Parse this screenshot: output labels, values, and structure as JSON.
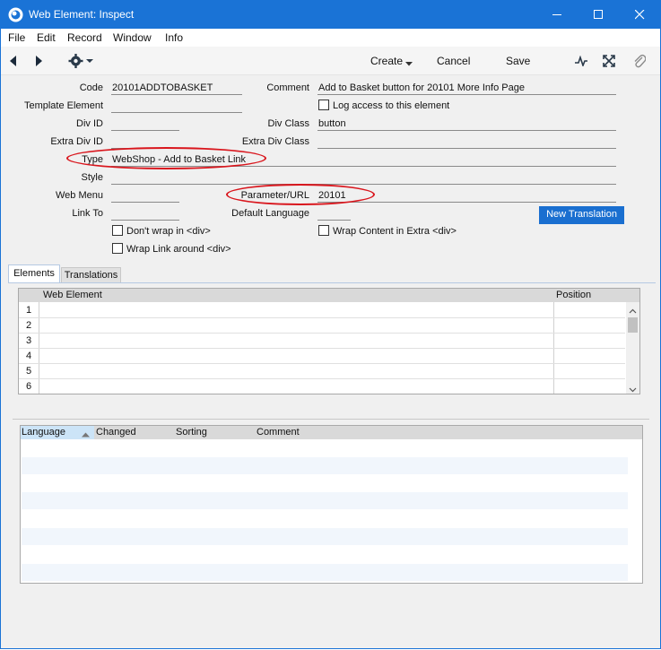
{
  "window": {
    "title": "Web Element: Inspect",
    "accent": "#1a73d6"
  },
  "menu": {
    "items": [
      "File",
      "Edit",
      "Record",
      "Window",
      "Info"
    ]
  },
  "toolbar": {
    "create_label": "Create",
    "cancel_label": "Cancel",
    "save_label": "Save"
  },
  "form": {
    "code_label": "Code",
    "code_value": "20101ADDTOBASKET",
    "comment_label": "Comment",
    "comment_value": "Add to Basket button for 20101 More Info Page",
    "template_element_label": "Template Element",
    "template_element_value": "",
    "log_access_label": "Log access to this element",
    "log_access_checked": false,
    "div_id_label": "Div ID",
    "div_id_value": "",
    "div_class_label": "Div Class",
    "div_class_value": "button",
    "extra_div_id_label": "Extra Div ID",
    "extra_div_id_value": "",
    "extra_div_class_label": "Extra Div Class",
    "extra_div_class_value": "",
    "type_label": "Type",
    "type_value": "WebShop - Add to Basket Link",
    "style_label": "Style",
    "style_value": "",
    "web_menu_label": "Web Menu",
    "web_menu_value": "",
    "parameter_label": "Parameter/URL",
    "parameter_value": "20101",
    "link_to_label": "Link To",
    "link_to_value": "",
    "default_language_label": "Default Language",
    "default_language_value": "",
    "new_translation_label": "New Translation",
    "dont_wrap_label": "Don't wrap in <div>",
    "wrap_content_label": "Wrap Content in Extra <div>",
    "wrap_link_label": "Wrap Link around <div>"
  },
  "tabs": {
    "elements_label": "Elements",
    "translations_label": "Translations"
  },
  "elements_grid": {
    "col_web_element": "Web Element",
    "col_position": "Position",
    "rows": [
      "1",
      "2",
      "3",
      "4",
      "5",
      "6"
    ]
  },
  "translations_grid": {
    "col_language": "Language",
    "col_changed": "Changed",
    "col_sorting": "Sorting",
    "col_comment": "Comment"
  },
  "highlight_color": "#d9161d"
}
